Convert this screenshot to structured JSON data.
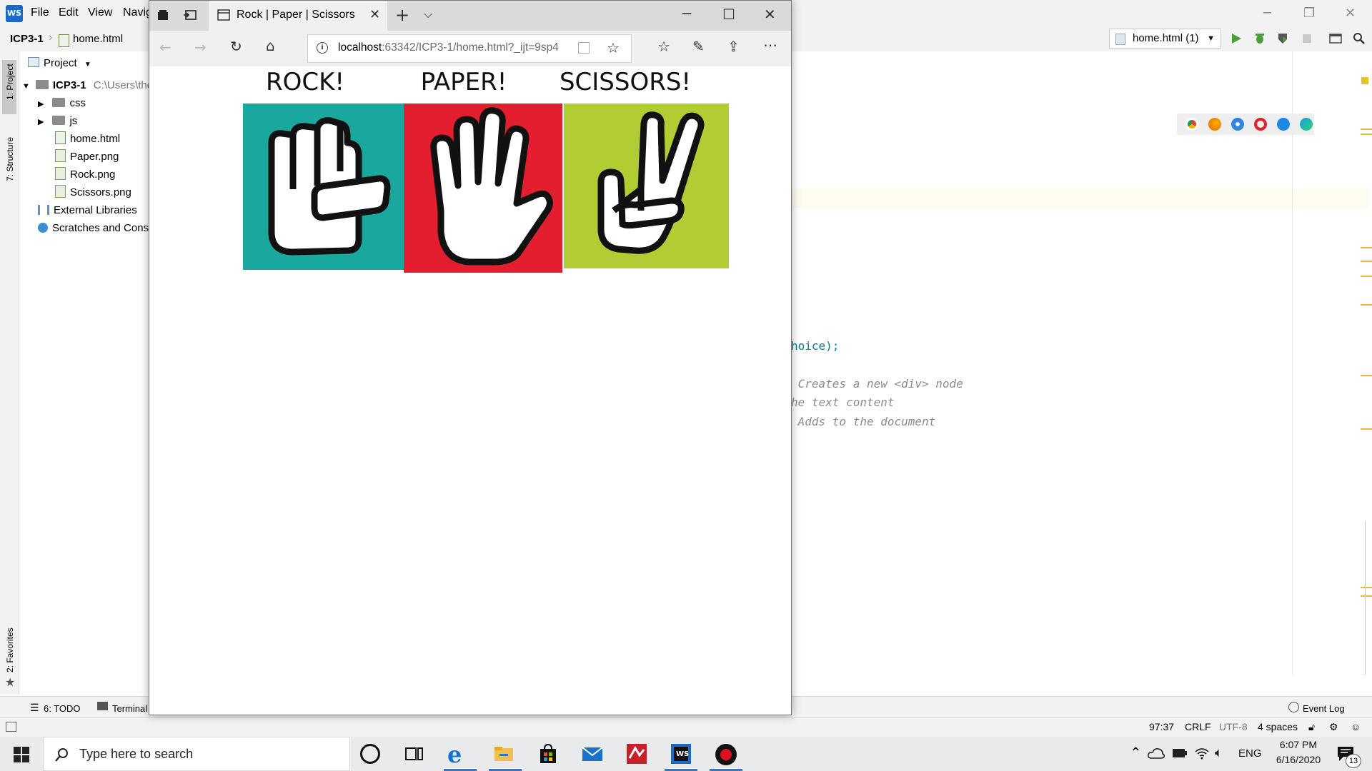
{
  "ide": {
    "menu": [
      "File",
      "Edit",
      "View",
      "Navig"
    ],
    "breadcrumb": {
      "project": "ICP3-1",
      "file": "home.html"
    },
    "run_config": "home.html (1)",
    "left_stripe": {
      "project": "1: Project",
      "structure": "7: Structure",
      "favorites": "2: Favorites"
    },
    "project_panel": {
      "header": "Project",
      "root": "ICP3-1",
      "root_path": "C:\\Users\\the",
      "items": [
        "css",
        "js",
        "home.html",
        "Paper.png",
        "Rock.png",
        "Scissors.png"
      ],
      "external": "External Libraries",
      "scratches": "Scratches and Conso"
    },
    "code_lines": [
      {
        "text": "hoice);",
        "kind": "code"
      },
      {
        "text": " Creates a new <div> node",
        "kind": "comment"
      },
      {
        "text": "he text content",
        "kind": "comment"
      },
      {
        "text": " Adds to the document",
        "kind": "comment"
      }
    ],
    "bottom_tools": {
      "todo": "6: TODO",
      "terminal": "Terminal",
      "event_log": "Event Log"
    },
    "status": {
      "position": "97:37",
      "line_sep": "CRLF",
      "encoding": "UTF-8",
      "indent": "4 spaces"
    }
  },
  "browser": {
    "tab_title": "Rock | Paper | Scissors",
    "url_host": "localhost",
    "url_rest": ":63342/ICP3-1/home.html?_ijt=9sp4",
    "labels": [
      "ROCK!",
      "PAPER!",
      "SCISSORS!"
    ],
    "tile_colors": {
      "rock": "#1aa79d",
      "paper": "#e21e2f",
      "scissors": "#b2cc34"
    }
  },
  "taskbar": {
    "search_placeholder": "Type here to search",
    "language": "ENG",
    "time": "6:07 PM",
    "date": "6/16/2020",
    "notification_count": "13"
  }
}
